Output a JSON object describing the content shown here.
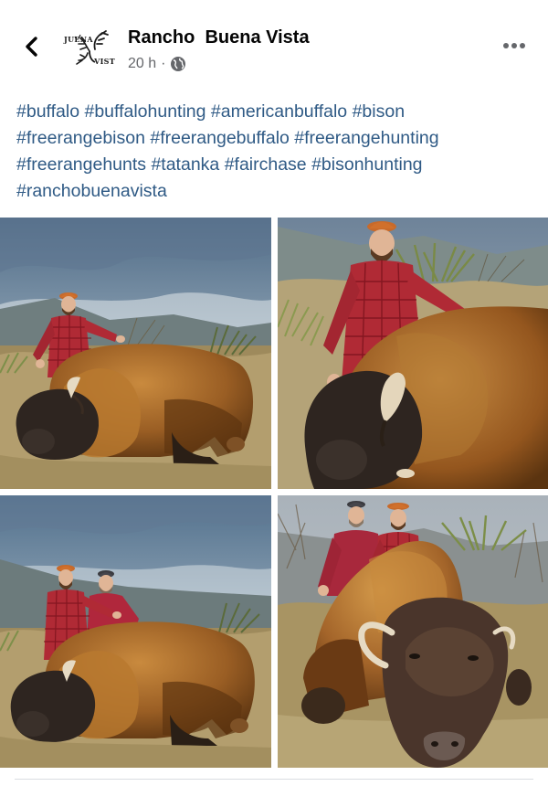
{
  "post": {
    "page_name": "Rancho  Buena Vista",
    "time": "20 h",
    "separator": "·",
    "audience_icon": "globe-icon",
    "avatar": {
      "logo_text_top": "JUENA",
      "logo_text_bottom": "VIST"
    },
    "back_icon": "chevron-left-icon",
    "more_icon": "more-options-icon"
  },
  "caption": {
    "hashtags": [
      "#buffalo",
      "#buffalohunting",
      "#americanbuffalo",
      "#bison",
      "#freerangebison",
      "#freerangebuffalo",
      "#freerangehunting",
      "#freerangehunts",
      "#tatanka",
      "#fairchase",
      "#bisonhunting",
      "#ranchobuenavista"
    ]
  },
  "colors": {
    "hashtag": "#2f5a85",
    "meta_text": "#65676b",
    "page_name": "#050505"
  },
  "photos": [
    {
      "name": "photo-hunter-with-bison-wide"
    },
    {
      "name": "photo-hunter-with-bison-closeup"
    },
    {
      "name": "photo-two-hunters-with-bison"
    },
    {
      "name": "photo-two-hunters-bison-front"
    }
  ]
}
